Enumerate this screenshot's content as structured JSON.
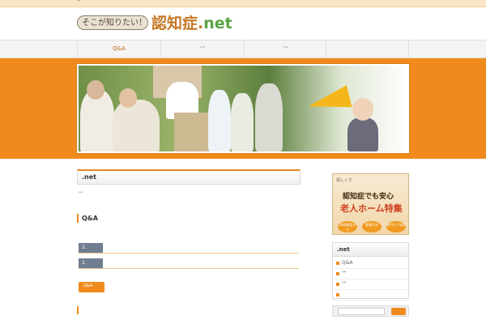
{
  "topbar": {
    "text": "\"\""
  },
  "logo": {
    "cloud_text": "そこが知りたい！",
    "main": "認知症",
    "dot": ".",
    "net": "net"
  },
  "nav": {
    "items": [
      "Q&A",
      "\"\"",
      "\"\"",
      ""
    ]
  },
  "main": {
    "section_title": ".net",
    "note": "\"\"",
    "qa_title": "Q&A",
    "rows": [
      {
        "num": "2."
      },
      {
        "num": "1."
      }
    ],
    "more_button": "Q&A"
  },
  "sidebar": {
    "ad": {
      "top": "探しくす",
      "title1": "認知症でも安心",
      "title2": "老人ホーム特集",
      "badges": [
        "24時間見守り",
        "食事付き",
        "専門ケア充実"
      ]
    },
    "widget": {
      "title": ".net",
      "items": [
        "Q&A",
        "\"\"",
        "\"\"",
        ""
      ]
    },
    "search": {
      "placeholder": ""
    }
  },
  "colors": {
    "accent": "#f08a1c",
    "nav_text": "#c36a10",
    "row_num_bg": "#6f7d90"
  }
}
